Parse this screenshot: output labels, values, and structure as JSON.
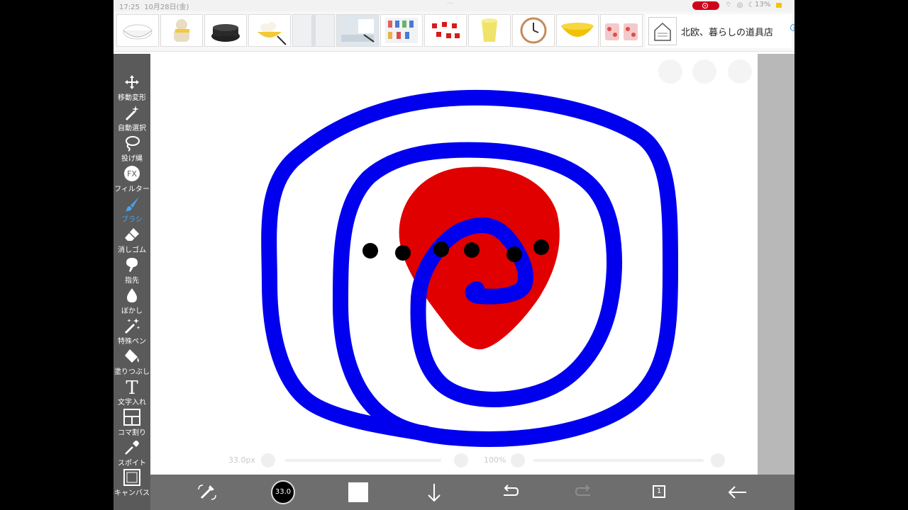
{
  "status_bar": {
    "time": "17:25",
    "date": "10月28日(金)",
    "battery": "13%"
  },
  "ad": {
    "thumbnails": [
      "washing-basin",
      "yellow-scarf-teddy",
      "black-cast-iron-pot",
      "bowl-of-eggs",
      "white-wall",
      "kitchen-sink",
      "blue-wall-rack",
      "red-cubes",
      "yellow-cup",
      "wall-clock",
      "yellow-bowl",
      "pink-pattern-cups"
    ],
    "store_text": "北欧、暮らしの道具店",
    "info_icon": "info-icon",
    "close_icon": "close-icon"
  },
  "tools": [
    {
      "label": "移動変形",
      "icon": "move-icon",
      "active": false
    },
    {
      "label": "自動選択",
      "icon": "magic-wand-icon",
      "active": false
    },
    {
      "label": "投げ縄",
      "icon": "lasso-icon",
      "active": false
    },
    {
      "label": "フィルター",
      "icon": "fx-icon",
      "icon_text": "FX",
      "active": false
    },
    {
      "label": "ブラシ",
      "icon": "brush-icon",
      "active": true
    },
    {
      "label": "消しゴム",
      "icon": "eraser-icon",
      "active": false
    },
    {
      "label": "指先",
      "icon": "finger-icon",
      "active": false
    },
    {
      "label": "ぼかし",
      "icon": "blur-drop-icon",
      "active": false
    },
    {
      "label": "特殊ペン",
      "icon": "special-pen-icon",
      "active": false
    },
    {
      "label": "塗りつぶし",
      "icon": "bucket-icon",
      "active": false
    },
    {
      "label": "文字入れ",
      "icon": "text-icon",
      "icon_text": "T",
      "active": false
    },
    {
      "label": "コマ割り",
      "icon": "panel-icon",
      "active": false
    },
    {
      "label": "スポイト",
      "icon": "eyedropper-icon",
      "active": false
    },
    {
      "label": "キャンバス",
      "icon": "canvas-icon",
      "active": false
    }
  ],
  "sliders": {
    "size_label": "33.0px",
    "opacity_label": "100%"
  },
  "bottom_bar": {
    "transform_icon": "swap-icon",
    "brush_size": "33.0",
    "primary_color": "#ffffff",
    "download_icon": "arrow-down-icon",
    "undo_icon": "undo-icon",
    "redo_icon": "redo-icon",
    "layer_count": "1",
    "back_icon": "arrow-left-icon"
  },
  "colors": {
    "stroke_blue": "#0000ee",
    "fill_red": "#e00000",
    "dots": "#000000",
    "active_tool": "#4aa3f0",
    "sidebar": "#5a5a5a",
    "bottom_bar": "#6e6e6e"
  }
}
